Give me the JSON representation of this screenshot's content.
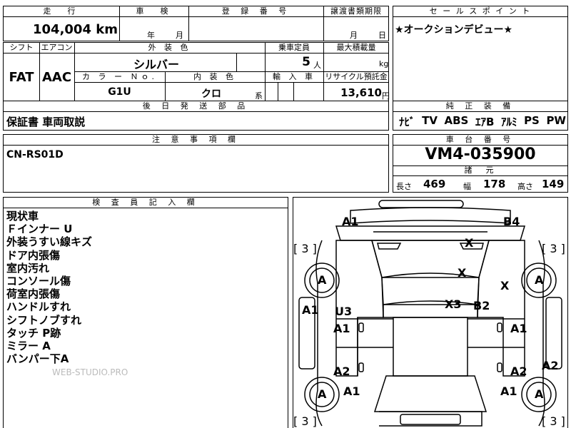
{
  "mileage": {
    "label": "走　行",
    "value": "104,004",
    "unit": "km"
  },
  "inspection": {
    "label": "車　検",
    "year_unit": "年",
    "month_unit": "月"
  },
  "registration": {
    "label": "登 録 番 号"
  },
  "transfer_deadline": {
    "label": "譲渡書類期限",
    "month_unit": "月",
    "day_unit": "日"
  },
  "sales_point": {
    "label": "セ ー ル ス ポ イ ン ト",
    "text": "★オークションデビュー★"
  },
  "shift": {
    "label": "シフト",
    "value": "FAT"
  },
  "aircon": {
    "label": "エアコン",
    "value": "AAC"
  },
  "exterior_color": {
    "label": "外 装 色",
    "value": "シルバー"
  },
  "capacity": {
    "label": "乗車定員",
    "value": "5",
    "unit": "人"
  },
  "max_load": {
    "label": "最大積載量",
    "unit": "kg"
  },
  "color_no": {
    "label": "カ ラ ー Ｎｏ.",
    "value": "G1U"
  },
  "interior_color": {
    "label": "内 装 色",
    "value": "クロ",
    "suffix": "系"
  },
  "import": {
    "label": "輸 入 車"
  },
  "recycle": {
    "label": "リサイクル預託金",
    "value": "13,610",
    "unit": "円"
  },
  "post_delivery": {
    "label": "後 日 発 送 部 品",
    "value": "保証書 車両取説"
  },
  "genuine_equipment": {
    "label": "純 正 装 備",
    "items": [
      "ﾅﾋﾞ",
      "TV",
      "ABS",
      "ｴｱB",
      "ｱﾙﾐ",
      "PS",
      "PW"
    ]
  },
  "notes": {
    "label": "注 意 事 項 欄",
    "value": "CN-RS01D"
  },
  "chassis": {
    "label": "車 台 番 号",
    "value": "VM4-035900"
  },
  "specs": {
    "label": "諸　元",
    "length_label": "長さ",
    "length_value": "469",
    "width_label": "幅",
    "width_value": "178",
    "height_label": "高さ",
    "height_value": "149"
  },
  "inspector_notes": {
    "label": "検 査 員 記 入 欄",
    "lines": [
      "現状車",
      "Ｆインナー U",
      "外装うすい線キズ",
      "ドア内張傷",
      "室内汚れ",
      "コンソール傷",
      "荷室内張傷",
      "ハンドルすれ",
      "シフトノブすれ",
      "タッチ P跡",
      "ミラー A",
      "バンパー下A"
    ]
  },
  "watermark": "WEB-STUDIO.PRO",
  "diagram": {
    "tire_rating": "3",
    "wheel_mark": "A",
    "marks": [
      "A1",
      "B4",
      "X",
      "X",
      "X",
      "X3",
      "B2",
      "U3",
      "A1",
      "A1",
      "A1",
      "A2",
      "A2",
      "A2",
      "A1",
      "A1",
      "A1"
    ]
  }
}
